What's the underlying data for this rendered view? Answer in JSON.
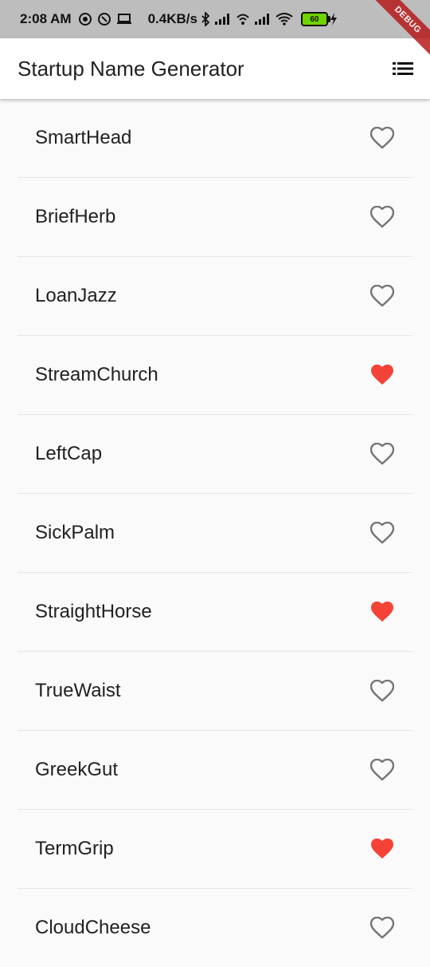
{
  "status_bar": {
    "time": "2:08 AM",
    "network_speed": "0.4KB/s",
    "battery_level": "60"
  },
  "debug_banner": "DEBUG",
  "app_bar": {
    "title": "Startup Name Generator",
    "menu_icon": "list-icon"
  },
  "colors": {
    "favorite": "#f44336",
    "not_favorite": "#757575",
    "background": "#fafafa"
  },
  "items": [
    {
      "name": "SmartHead",
      "saved": false
    },
    {
      "name": "BriefHerb",
      "saved": false
    },
    {
      "name": "LoanJazz",
      "saved": false
    },
    {
      "name": "StreamChurch",
      "saved": true
    },
    {
      "name": "LeftCap",
      "saved": false
    },
    {
      "name": "SickPalm",
      "saved": false
    },
    {
      "name": "StraightHorse",
      "saved": true
    },
    {
      "name": "TrueWaist",
      "saved": false
    },
    {
      "name": "GreekGut",
      "saved": false
    },
    {
      "name": "TermGrip",
      "saved": true
    },
    {
      "name": "CloudCheese",
      "saved": false
    }
  ]
}
